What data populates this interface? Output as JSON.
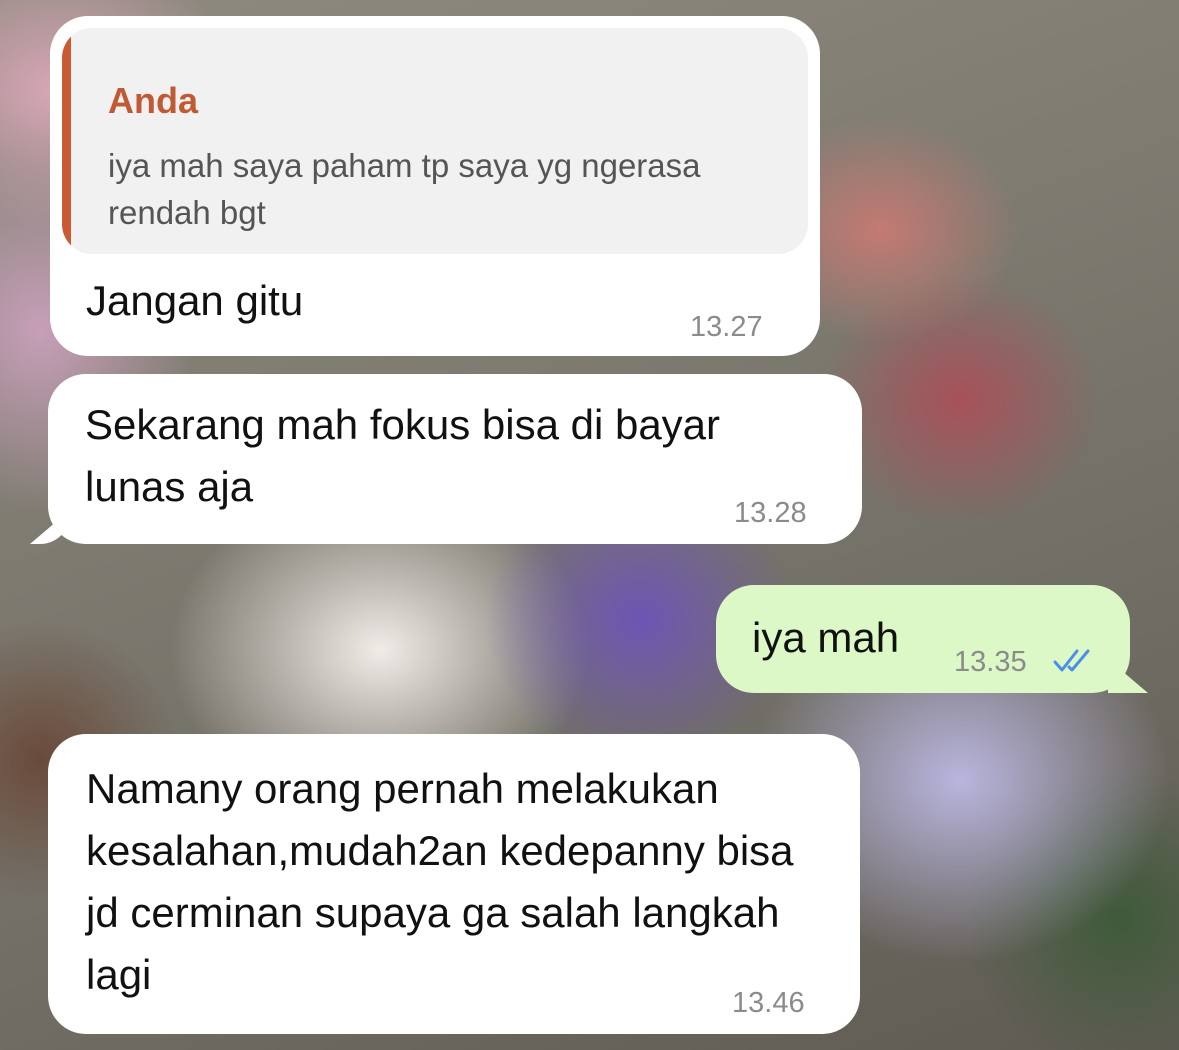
{
  "colors": {
    "incoming_bubble": "#ffffff",
    "outgoing_bubble": "#dcf8c6",
    "quote_accent": "#c85a34",
    "read_ticks": "#4a8fe7"
  },
  "messages": [
    {
      "direction": "incoming",
      "quote": {
        "author": "Anda",
        "text": "iya mah saya paham tp saya yg ngerasa rendah bgt"
      },
      "text": "Jangan gitu",
      "time": "13.27"
    },
    {
      "direction": "incoming",
      "text": "Sekarang mah fokus bisa di bayar lunas aja",
      "time": "13.28"
    },
    {
      "direction": "outgoing",
      "text": "iya mah",
      "time": "13.35",
      "status_icon": "double-check-read-icon"
    },
    {
      "direction": "incoming",
      "text": "Namany orang pernah melakukan kesalahan,mudah2an kedepanny bisa jd cerminan supaya ga salah langkah lagi",
      "time": "13.46"
    }
  ]
}
